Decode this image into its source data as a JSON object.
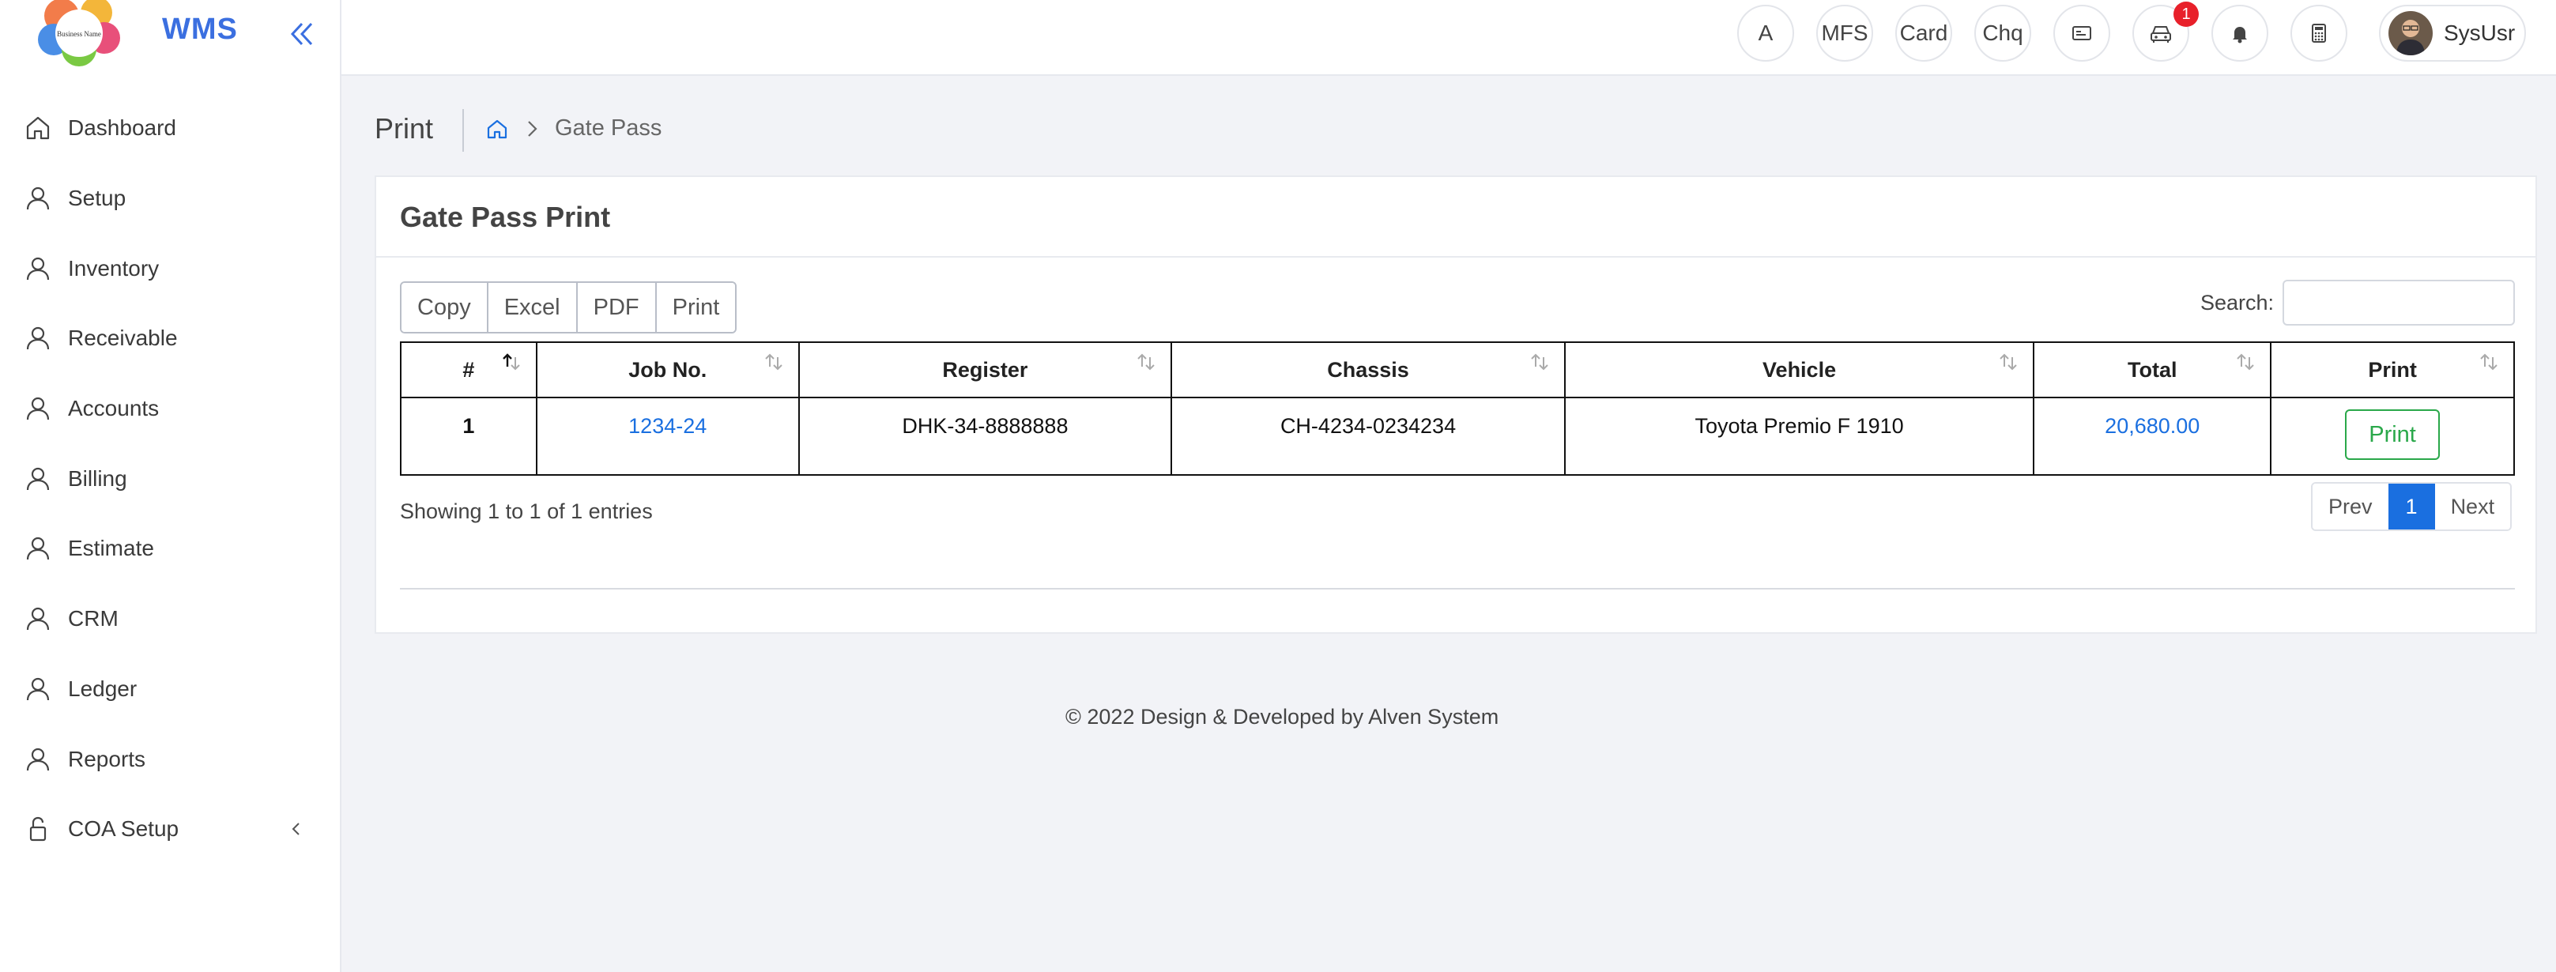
{
  "brand": {
    "logo_text": "Business Name",
    "app_name": "WMS"
  },
  "sidebar": {
    "items": [
      {
        "label": "Dashboard",
        "icon": "home-icon"
      },
      {
        "label": "Setup",
        "icon": "user-icon"
      },
      {
        "label": "Inventory",
        "icon": "user-icon"
      },
      {
        "label": "Receivable",
        "icon": "user-icon"
      },
      {
        "label": "Accounts",
        "icon": "user-icon"
      },
      {
        "label": "Billing",
        "icon": "user-icon"
      },
      {
        "label": "Estimate",
        "icon": "user-icon"
      },
      {
        "label": "CRM",
        "icon": "user-icon"
      },
      {
        "label": "Ledger",
        "icon": "user-icon"
      },
      {
        "label": "Reports",
        "icon": "user-icon"
      },
      {
        "label": "COA Setup",
        "icon": "lock-icon"
      }
    ]
  },
  "topbar": {
    "buttons": [
      {
        "label": "A"
      },
      {
        "label": "MFS"
      },
      {
        "label": "Card"
      },
      {
        "label": "Chq"
      }
    ],
    "car_badge": "1",
    "user_name": "SysUsr"
  },
  "page": {
    "title": "Print",
    "breadcrumb": "Gate Pass"
  },
  "card": {
    "title": "Gate Pass Print",
    "export_buttons": [
      "Copy",
      "Excel",
      "PDF",
      "Print"
    ],
    "search_label": "Search:",
    "search_value": "",
    "columns": [
      "#",
      "Job No.",
      "Register",
      "Chassis",
      "Vehicle",
      "Total",
      "Print"
    ],
    "rows": [
      {
        "num": "1",
        "job_no": "1234-24",
        "register": "DHK-34-8888888",
        "chassis": "CH-4234-0234234",
        "vehicle": "Toyota Premio F 1910",
        "total": "20,680.00",
        "print": "Print"
      }
    ],
    "info": "Showing 1 to 1 of 1 entries",
    "pager": {
      "prev": "Prev",
      "current": "1",
      "next": "Next"
    }
  },
  "footer": "© 2022 Design & Developed by Alven System",
  "colors": {
    "accent": "#1a6fe0",
    "brand": "#3b6fe0",
    "success": "#2aa84a",
    "badge": "#e8202a"
  }
}
